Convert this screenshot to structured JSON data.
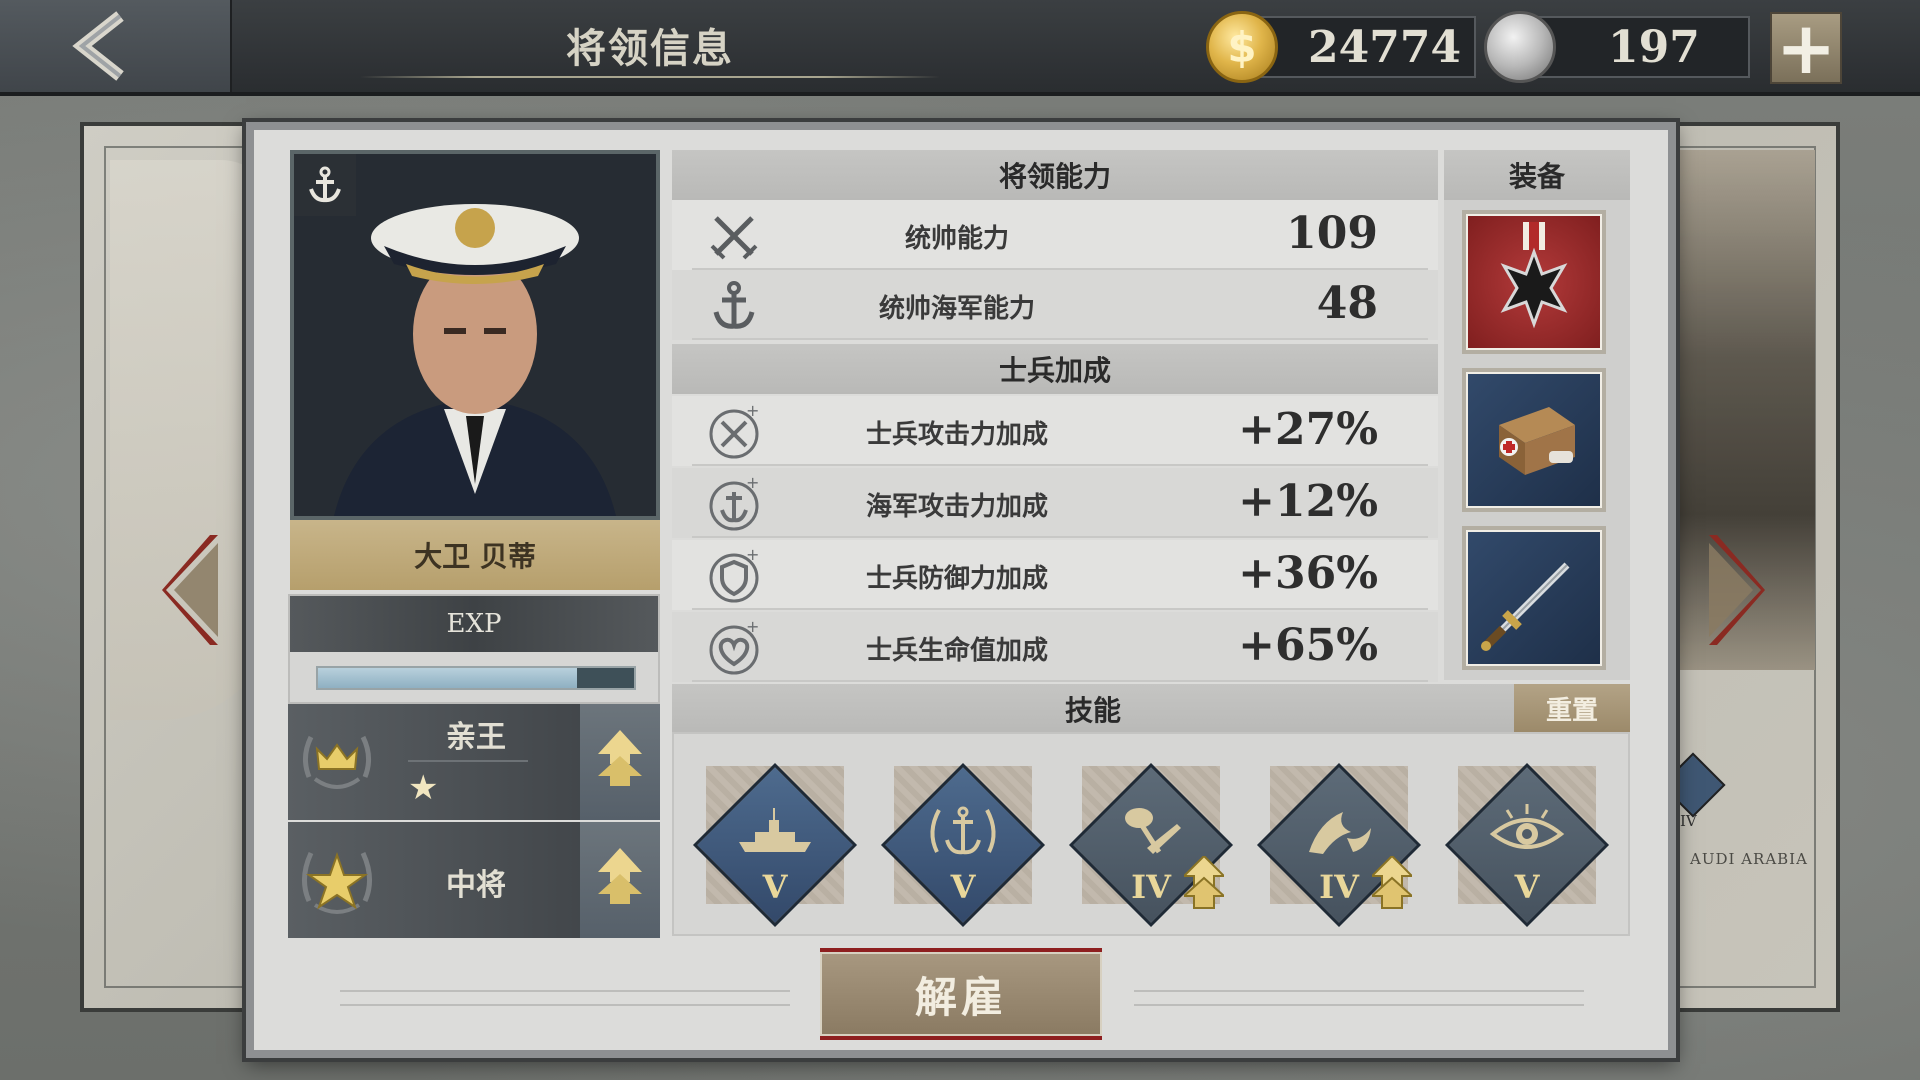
{
  "header": {
    "title": "将领信息",
    "gold": "24774",
    "medals": "197"
  },
  "general": {
    "name": "大卫 贝蒂",
    "exp_label": "EXP",
    "exp_progress": 0.82,
    "title_rank": "亲王",
    "title_stars": "★",
    "military_rank": "中将"
  },
  "abilities": {
    "header": "将领能力",
    "rows": [
      {
        "icon": "crossed-swords-icon",
        "label": "统帅能力",
        "value": "109"
      },
      {
        "icon": "anchor-icon",
        "label": "统帅海军能力",
        "value": "48"
      }
    ]
  },
  "bonuses": {
    "header": "士兵加成",
    "rows": [
      {
        "icon": "attack-bonus-icon",
        "label": "士兵攻击力加成",
        "value": "+27%"
      },
      {
        "icon": "naval-attack-bonus-icon",
        "label": "海军攻击力加成",
        "value": "+12%"
      },
      {
        "icon": "defense-bonus-icon",
        "label": "士兵防御力加成",
        "value": "+36%"
      },
      {
        "icon": "health-bonus-icon",
        "label": "士兵生命值加成",
        "value": "+65%"
      }
    ]
  },
  "equipment": {
    "header": "装备",
    "items": [
      {
        "icon": "iron-cross-medal-icon"
      },
      {
        "icon": "medical-kit-icon"
      },
      {
        "icon": "sword-icon"
      }
    ]
  },
  "skills": {
    "header": "技能",
    "reset_label": "重置",
    "items": [
      {
        "icon": "battleship-icon",
        "level": "V",
        "upgradable": false,
        "color": "navy"
      },
      {
        "icon": "anchor-laurel-icon",
        "level": "V",
        "upgradable": false,
        "color": "navy"
      },
      {
        "icon": "hammer-knife-icon",
        "level": "IV",
        "upgradable": true,
        "color": "grey"
      },
      {
        "icon": "flag-knife-icon",
        "level": "IV",
        "upgradable": true,
        "color": "grey"
      },
      {
        "icon": "eye-icon",
        "level": "V",
        "upgradable": false,
        "color": "grey"
      }
    ]
  },
  "actions": {
    "dismiss_label": "解雇"
  },
  "map": {
    "region_label": "AUDI ARABIA",
    "badge_level": "IV"
  },
  "colors": {
    "accent_gold": "#b69f6c",
    "dismiss_red": "#8e1f1f",
    "skill_navy": "#3f5a7e",
    "skill_level_text": "#e9d79a"
  }
}
